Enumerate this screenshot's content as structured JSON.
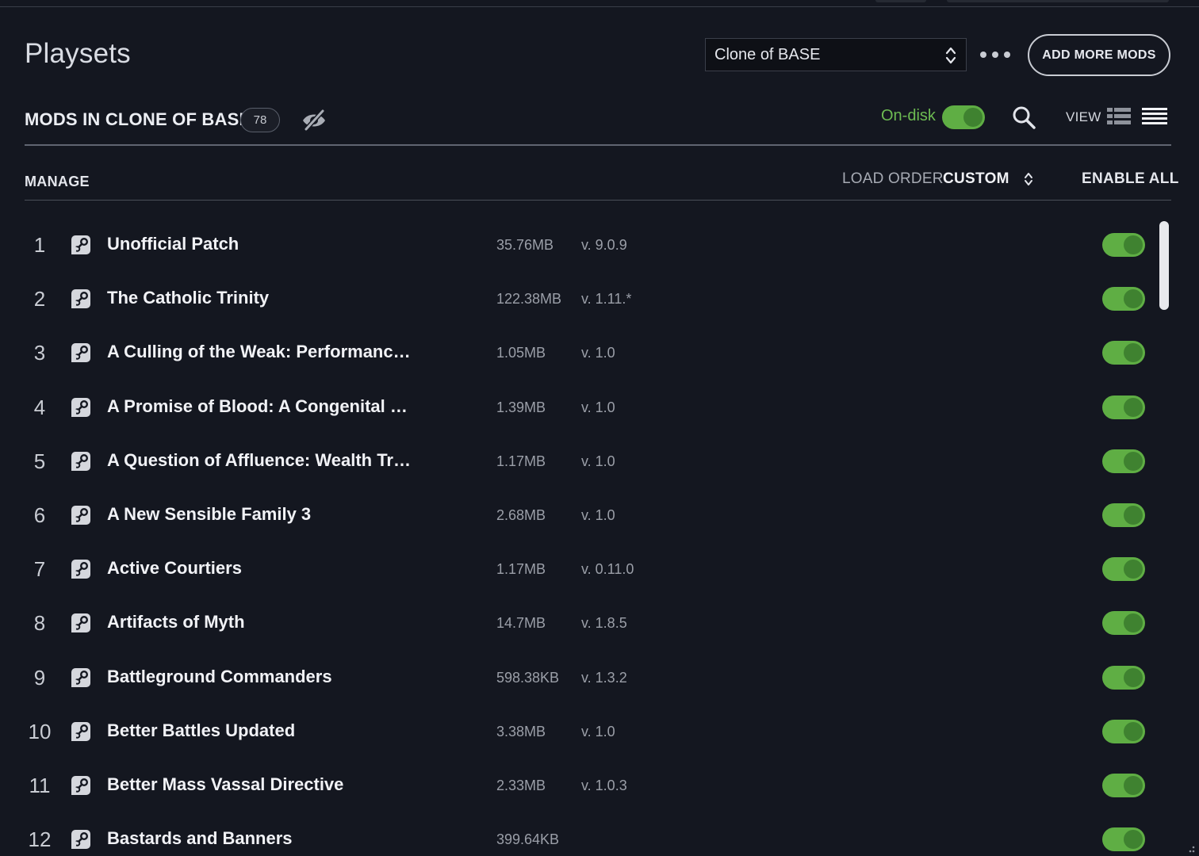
{
  "header": {
    "title": "Playsets",
    "playset_selected": "Clone of BASE",
    "add_mods_label": "ADD MORE MODS"
  },
  "toolbar": {
    "mods_heading": "MODS IN CLONE OF BASE",
    "mod_count": "78",
    "ondisk_label": "On-disk",
    "ondisk_enabled": true,
    "view_label": "VIEW"
  },
  "manage_bar": {
    "manage_label": "MANAGE",
    "load_order_label": "LOAD ORDER",
    "load_order_value": "CUSTOM",
    "enable_all_label": "ENABLE ALL"
  },
  "colors": {
    "accent_green": "#5fae44",
    "background": "#141720"
  },
  "mods": [
    {
      "index": "1",
      "name": "Unofficial Patch",
      "size": "35.76MB",
      "version": "v. 9.0.9",
      "enabled": true,
      "source_icon": "steam-icon"
    },
    {
      "index": "2",
      "name": "The Catholic Trinity",
      "size": "122.38MB",
      "version": "v. 1.11.*",
      "enabled": true,
      "source_icon": "steam-icon"
    },
    {
      "index": "3",
      "name": "A Culling of the Weak: Performanc…",
      "size": "1.05MB",
      "version": "v. 1.0",
      "enabled": true,
      "source_icon": "steam-icon"
    },
    {
      "index": "4",
      "name": "A Promise of Blood: A Congenital …",
      "size": "1.39MB",
      "version": "v. 1.0",
      "enabled": true,
      "source_icon": "steam-icon"
    },
    {
      "index": "5",
      "name": "A Question of Affluence: Wealth Tr…",
      "size": "1.17MB",
      "version": "v. 1.0",
      "enabled": true,
      "source_icon": "steam-icon"
    },
    {
      "index": "6",
      "name": "A New Sensible Family 3",
      "size": "2.68MB",
      "version": "v. 1.0",
      "enabled": true,
      "source_icon": "steam-icon"
    },
    {
      "index": "7",
      "name": "Active Courtiers",
      "size": "1.17MB",
      "version": "v. 0.11.0",
      "enabled": true,
      "source_icon": "steam-icon"
    },
    {
      "index": "8",
      "name": "Artifacts of Myth",
      "size": "14.7MB",
      "version": "v. 1.8.5",
      "enabled": true,
      "source_icon": "steam-icon"
    },
    {
      "index": "9",
      "name": "Battleground Commanders",
      "size": "598.38KB",
      "version": "v. 1.3.2",
      "enabled": true,
      "source_icon": "steam-icon"
    },
    {
      "index": "10",
      "name": "Better Battles Updated",
      "size": "3.38MB",
      "version": "v. 1.0",
      "enabled": true,
      "source_icon": "steam-icon"
    },
    {
      "index": "11",
      "name": "Better Mass Vassal Directive",
      "size": "2.33MB",
      "version": "v. 1.0.3",
      "enabled": true,
      "source_icon": "steam-icon"
    },
    {
      "index": "12",
      "name": "Bastards and Banners",
      "size": "399.64KB",
      "version": "",
      "enabled": true,
      "source_icon": "steam-icon"
    }
  ]
}
